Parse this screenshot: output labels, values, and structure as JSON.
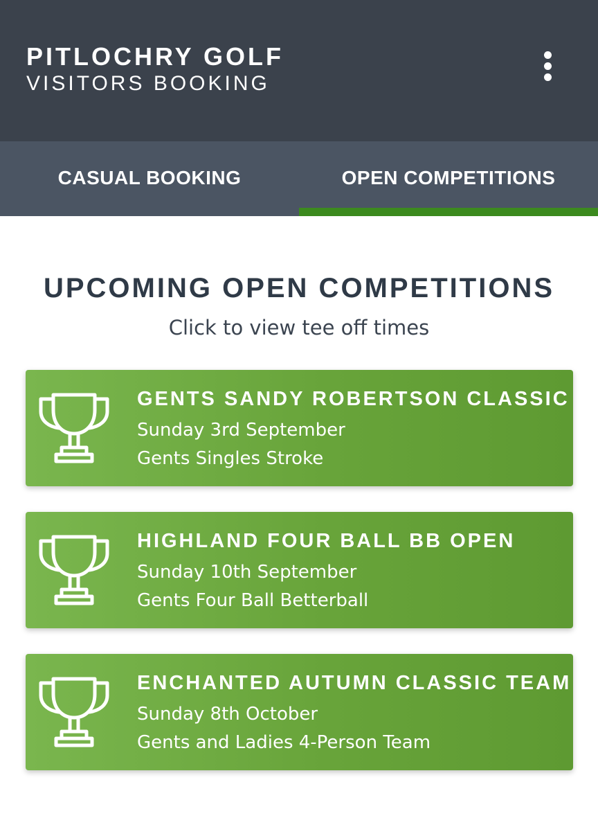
{
  "header": {
    "title": "PITLOCHRY GOLF",
    "subtitle": "VISITORS BOOKING",
    "menu_icon": "more-vertical-icon"
  },
  "tabs": [
    {
      "label": "CASUAL BOOKING",
      "active": false
    },
    {
      "label": "OPEN COMPETITIONS",
      "active": true
    }
  ],
  "main": {
    "heading": "UPCOMING OPEN COMPETITIONS",
    "subheading": "Click to view tee off times",
    "competitions": [
      {
        "title": "GENTS SANDY ROBERTSON CLASSIC OPEN",
        "date": "Sunday 3rd September",
        "format": "Gents Singles Stroke",
        "icon": "trophy-icon"
      },
      {
        "title": "HIGHLAND FOUR BALL BB OPEN",
        "date": "Sunday 10th September",
        "format": "Gents Four Ball Betterball",
        "icon": "trophy-icon"
      },
      {
        "title": "ENCHANTED AUTUMN CLASSIC TEAM",
        "date": "Sunday 8th October",
        "format": "Gents and Ladies 4-Person Team",
        "icon": "trophy-icon"
      }
    ]
  },
  "colors": {
    "header_bg": "#3b424c",
    "tabs_bg": "#4b5563",
    "tab_indicator": "#3c8a1e",
    "card_green": "#6aa63c",
    "heading_text": "#2f3a47"
  }
}
